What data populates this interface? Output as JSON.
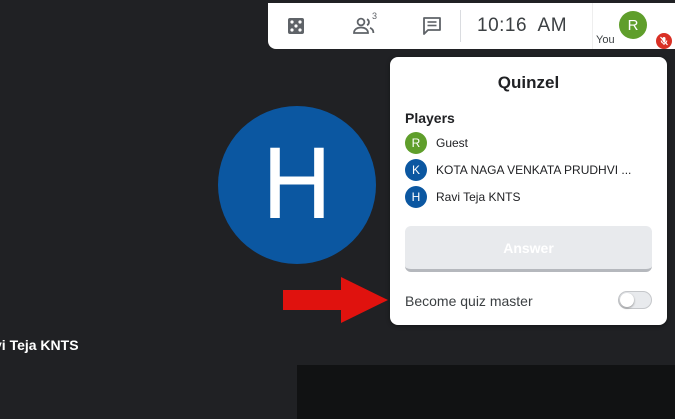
{
  "topbar": {
    "activities_icon": "dice-icon",
    "people_icon": "people-icon",
    "people_count": "3",
    "chat_icon": "chat-icon",
    "time": "10:16  AM",
    "self": {
      "avatar_letter": "R",
      "label": "You",
      "mic_state": "muted"
    }
  },
  "main": {
    "speaker_avatar_letter": "H",
    "participant_name": "vi Teja KNTS"
  },
  "panel": {
    "title": "Quinzel",
    "players_heading": "Players",
    "players": [
      {
        "avatar_letter": "R",
        "name": "Guest",
        "color": "#5f9e2b"
      },
      {
        "avatar_letter": "K",
        "name": "KOTA NAGA VENKATA PRUDHVI ...",
        "color": "#0b57a1"
      },
      {
        "avatar_letter": "H",
        "name": "Ravi Teja KNTS",
        "color": "#0b57a1"
      }
    ],
    "answer_button": "Answer",
    "quiz_master_label": "Become quiz master",
    "quiz_master_enabled": false
  },
  "colors": {
    "accent_blue": "#0b57a1",
    "self_green": "#5f9e2b",
    "arrow_red": "#e0120e"
  }
}
